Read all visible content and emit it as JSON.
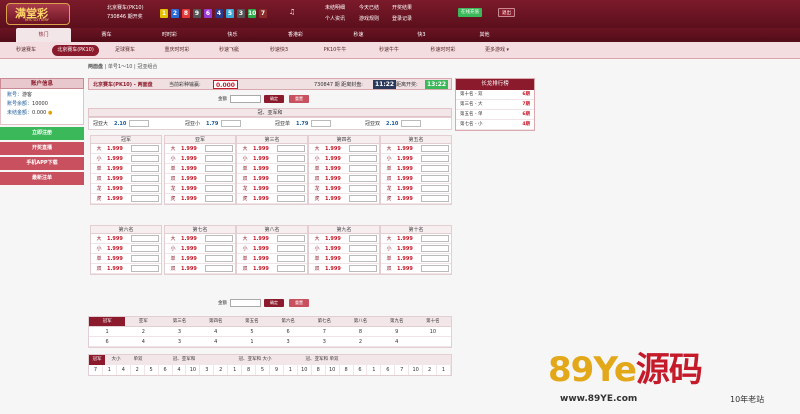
{
  "header": {
    "logo_text": "满堂彩",
    "logo_sub": "MTC LOTTERY",
    "game_name": "北京赛车(PK10)",
    "issue": "730846 期开奖",
    "balls": [
      {
        "n": "1",
        "color": "#e4c200"
      },
      {
        "n": "2",
        "color": "#2a6ad6"
      },
      {
        "n": "8",
        "color": "#e23a3a"
      },
      {
        "n": "9",
        "color": "#555555"
      },
      {
        "n": "6",
        "color": "#9a3ad6"
      },
      {
        "n": "4",
        "color": "#2a3a8a"
      },
      {
        "n": "5",
        "color": "#3aa8d6"
      },
      {
        "n": "3",
        "color": "#555555"
      },
      {
        "n": "10",
        "color": "#2aa84a"
      },
      {
        "n": "7",
        "color": "#8a2a2a"
      }
    ],
    "links_row1": [
      "未结明细",
      "今天已结",
      "开奖结果"
    ],
    "links_row2": [
      "个人资讯",
      "游戏规则",
      "登录记录"
    ],
    "btn_green": "在线充值",
    "btn_logout": "退出"
  },
  "nav1": [
    "热门",
    "赛车",
    "时时彩",
    "快乐",
    "香港彩",
    "秒速",
    "快3",
    "其他"
  ],
  "nav2": [
    "秒速赛车",
    "北京赛车(PK10)",
    "足球赛车",
    "重庆时时彩",
    "秒速飞艇",
    "秒速快3",
    "PK10牛牛",
    "秒速牛牛",
    "秒速时时彩",
    "更多游戏 ▾"
  ],
  "crumb": {
    "label": "两面盘",
    "items": [
      "单号1～10",
      "冠亚组合"
    ]
  },
  "sidebar": {
    "title": "账户信息",
    "account_label": "账号：",
    "account": "游客",
    "credit_label": "账号余额：",
    "credit": "10000",
    "unsettled_label": "未结金额：",
    "unsettled": "0.000",
    "buttons": [
      {
        "label": "立即注册",
        "color": "#3ab85a"
      },
      {
        "label": "开奖直播",
        "color": "#c9515f"
      },
      {
        "label": "手机APP下载",
        "color": "#c9515f"
      },
      {
        "label": "最新注单",
        "color": "#c9515f"
      }
    ]
  },
  "main": {
    "game_title": "北京赛车(PK10) - 两面盘",
    "current_bet_label": "当前彩种输赢:",
    "current_bet": "0.000",
    "close_label": "730847 期 距离封盘:",
    "close_time": "11:22",
    "draw_label": "距离开奖:",
    "draw_time": "13:22",
    "amount_label": "金额",
    "confirm": "确定",
    "reset": "重置",
    "gy_title": "冠、亚军和",
    "gy": [
      {
        "label": "冠亚大",
        "odds": "2.10"
      },
      {
        "label": "冠亚小",
        "odds": "1.79"
      },
      {
        "label": "冠亚单",
        "odds": "1.79"
      },
      {
        "label": "冠亚双",
        "odds": "2.10"
      }
    ],
    "blocks_top": [
      "冠军",
      "亚军",
      "第三名",
      "第四名",
      "第五名"
    ],
    "blocks_bottom": [
      "第六名",
      "第七名",
      "第八名",
      "第九名",
      "第十名"
    ],
    "rows6": [
      "大",
      "小",
      "单",
      "双",
      "龙",
      "虎"
    ],
    "rows4": [
      "大",
      "小",
      "单",
      "双"
    ],
    "odds": "1.999"
  },
  "result": {
    "headers": [
      "冠军",
      "亚军",
      "第三名",
      "第四名",
      "第五名",
      "第六名",
      "第七名",
      "第八名",
      "第九名",
      "第十名"
    ],
    "row1": [
      "1",
      "2",
      "3",
      "4",
      "5",
      "6",
      "7",
      "8",
      "9",
      "10"
    ],
    "row2": [
      "6",
      "4",
      "3",
      "4",
      "1",
      "3",
      "3",
      "2",
      "4",
      ""
    ]
  },
  "history": {
    "tabs": [
      "冠军",
      "大小",
      "单双",
      "冠、亚军和",
      "冠、亚军和 大小",
      "冠、亚军和 单双"
    ],
    "row": [
      "7",
      "1",
      "4",
      "2",
      "5",
      "6",
      "4",
      "10",
      "3",
      "2",
      "1",
      "8",
      "5",
      "9",
      "1",
      "10",
      "8",
      "10",
      "8",
      "6",
      "1",
      "6",
      "7",
      "10",
      "2",
      "1"
    ]
  },
  "rank": {
    "title": "长龙排行榜",
    "items": [
      {
        "name": "第十名 - 双",
        "val": "6期"
      },
      {
        "name": "第三名 - 大",
        "val": "7期"
      },
      {
        "name": "第五名 - 单",
        "val": "6期"
      },
      {
        "name": "第七名 - 小",
        "val": "4期"
      }
    ]
  },
  "watermark": {
    "big": "89Ye源码",
    "url": "www.89YE.com",
    "tag": "10年老站"
  }
}
